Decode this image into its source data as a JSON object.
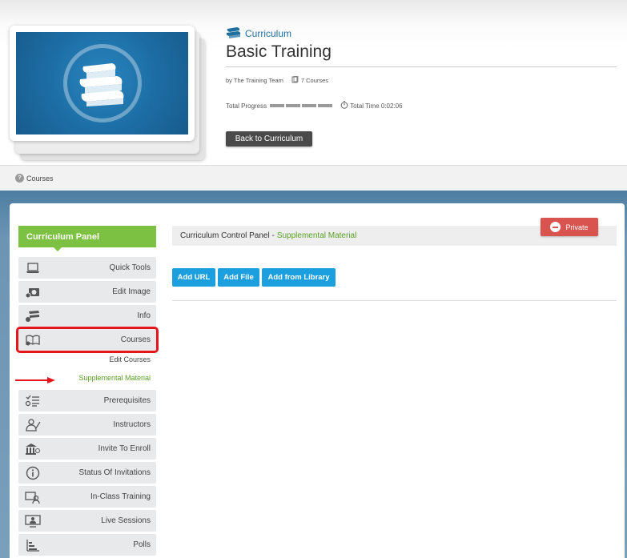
{
  "header": {
    "category": "Curriculum",
    "title": "Basic Training",
    "author": "by The Training Team",
    "course_count": "7 Courses",
    "total_progress_label": "Total Progress",
    "total_time": "Total Time 0:02:06",
    "back_button": "Back to Curriculum"
  },
  "breadcrumb": {
    "label": "Courses"
  },
  "sidebar": {
    "title": "Curriculum Panel",
    "items": [
      {
        "label": "Quick Tools",
        "icon": "laptop-icon"
      },
      {
        "label": "Edit Image",
        "icon": "camera-gear-icon"
      },
      {
        "label": "Info",
        "icon": "books-gear-icon"
      },
      {
        "label": "Courses",
        "icon": "open-book-gear-icon"
      },
      {
        "label": "Prerequisites",
        "icon": "checklist-icon"
      },
      {
        "label": "Instructors",
        "icon": "instructor-icon"
      },
      {
        "label": "Invite To Enroll",
        "icon": "building-user-icon"
      },
      {
        "label": "Status Of Invitations",
        "icon": "info-icon"
      },
      {
        "label": "In-Class Training",
        "icon": "classroom-icon"
      },
      {
        "label": "Live Sessions",
        "icon": "monitor-user-icon"
      },
      {
        "label": "Polls",
        "icon": "bar-chart-icon"
      }
    ],
    "subitems": {
      "edit_courses": "Edit Courses",
      "supplemental_material": "Supplemental Material"
    }
  },
  "content": {
    "control_panel": "Curriculum Control Panel -",
    "section": "Supplemental Material",
    "private_button": "Private",
    "buttons": {
      "add_url": "Add URL",
      "add_file": "Add File",
      "add_library": "Add from Library"
    }
  },
  "colors": {
    "accent_green": "#7dc142",
    "button_blue": "#1b9fde",
    "private_red": "#d9534f",
    "highlight_red": "#e8141b"
  }
}
